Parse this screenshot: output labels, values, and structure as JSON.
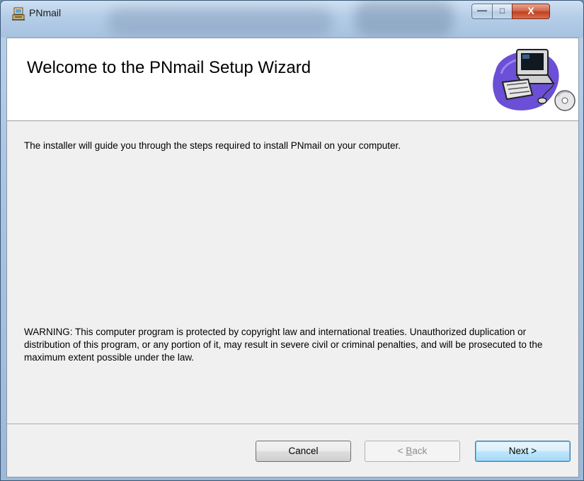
{
  "window": {
    "title": "PNmail",
    "controls": {
      "minimize": "—",
      "maximize": "□",
      "close": "X"
    }
  },
  "banner": {
    "heading": "Welcome to the PNmail Setup Wizard"
  },
  "body": {
    "intro": "The installer will guide you through the steps required to install PNmail on your computer.",
    "warning": "WARNING: This computer program is protected by copyright law and international treaties. Unauthorized duplication or distribution of this program, or any portion of it, may result in severe civil or criminal penalties, and will be prosecuted to the maximum extent possible under the law."
  },
  "buttons": {
    "cancel": "Cancel",
    "back_prefix": "< ",
    "back_access": "B",
    "back_rest": "ack",
    "next": "Next >"
  },
  "colors": {
    "dialog_bg": "#f0f0f0",
    "banner_bg": "#ffffff",
    "close_button": "#c2401e",
    "default_button_border": "#3c7fb1"
  },
  "icons": [
    "installer-app-icon",
    "computer-setup-illustration"
  ]
}
